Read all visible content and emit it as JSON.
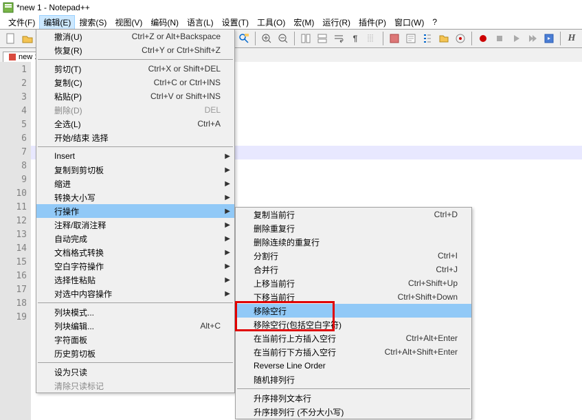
{
  "window": {
    "title": "*new 1 - Notepad++"
  },
  "menubar": {
    "items": [
      "文件(F)",
      "编辑(E)",
      "搜索(S)",
      "视图(V)",
      "编码(N)",
      "语言(L)",
      "设置(T)",
      "工具(O)",
      "宏(M)",
      "运行(R)",
      "插件(P)",
      "窗口(W)",
      "?"
    ],
    "active_index": 1
  },
  "tab": {
    "label": "new 1"
  },
  "gutter_lines": [
    "1",
    "2",
    "3",
    "4",
    "5",
    "6",
    "7",
    "8",
    "9",
    "10",
    "11",
    "12",
    "13",
    "14",
    "15",
    "16",
    "17",
    "18",
    "19"
  ],
  "current_line_index": 6,
  "edit_menu": [
    {
      "label": "撤消(U)",
      "shortcut": "Ctrl+Z or Alt+Backspace"
    },
    {
      "label": "恢复(R)",
      "shortcut": "Ctrl+Y or Ctrl+Shift+Z"
    },
    {
      "sep": true
    },
    {
      "label": "剪切(T)",
      "shortcut": "Ctrl+X or Shift+DEL"
    },
    {
      "label": "复制(C)",
      "shortcut": "Ctrl+C or Ctrl+INS"
    },
    {
      "label": "粘贴(P)",
      "shortcut": "Ctrl+V or Shift+INS"
    },
    {
      "label": "删除(D)",
      "shortcut": "DEL",
      "disabled": true
    },
    {
      "label": "全选(L)",
      "shortcut": "Ctrl+A"
    },
    {
      "label": "开始/结束 选择"
    },
    {
      "sep": true
    },
    {
      "label": "Insert",
      "submenu": true
    },
    {
      "label": "复制到剪切板",
      "submenu": true
    },
    {
      "label": "缩进",
      "submenu": true
    },
    {
      "label": "转换大小写",
      "submenu": true
    },
    {
      "label": "行操作",
      "submenu": true,
      "highlight": true
    },
    {
      "label": "注释/取消注释",
      "submenu": true
    },
    {
      "label": "自动完成",
      "submenu": true
    },
    {
      "label": "文档格式转换",
      "submenu": true
    },
    {
      "label": "空白字符操作",
      "submenu": true
    },
    {
      "label": "选择性粘贴",
      "submenu": true
    },
    {
      "label": "对选中内容操作",
      "submenu": true
    },
    {
      "sep": true
    },
    {
      "label": "列块模式..."
    },
    {
      "label": "列块编辑...",
      "shortcut": "Alt+C"
    },
    {
      "label": "字符面板"
    },
    {
      "label": "历史剪切板"
    },
    {
      "sep": true
    },
    {
      "label": "设为只读"
    },
    {
      "label": "清除只读标记",
      "disabled": true
    }
  ],
  "line_menu": [
    {
      "label": "复制当前行",
      "shortcut": "Ctrl+D"
    },
    {
      "label": "删除重复行"
    },
    {
      "label": "删除连续的重复行"
    },
    {
      "label": "分割行",
      "shortcut": "Ctrl+I"
    },
    {
      "label": "合并行",
      "shortcut": "Ctrl+J"
    },
    {
      "label": "上移当前行",
      "shortcut": "Ctrl+Shift+Up"
    },
    {
      "label": "下移当前行",
      "shortcut": "Ctrl+Shift+Down"
    },
    {
      "label": "移除空行",
      "highlight": true
    },
    {
      "label": "移除空行(包括空白字符)"
    },
    {
      "label": "在当前行上方插入空行",
      "shortcut": "Ctrl+Alt+Enter"
    },
    {
      "label": "在当前行下方插入空行",
      "shortcut": "Ctrl+Alt+Shift+Enter"
    },
    {
      "label": "Reverse Line Order"
    },
    {
      "label": "随机排列行"
    },
    {
      "sep": true
    },
    {
      "label": "升序排列文本行"
    },
    {
      "label": "升序排列行 (不分大小写)"
    }
  ]
}
